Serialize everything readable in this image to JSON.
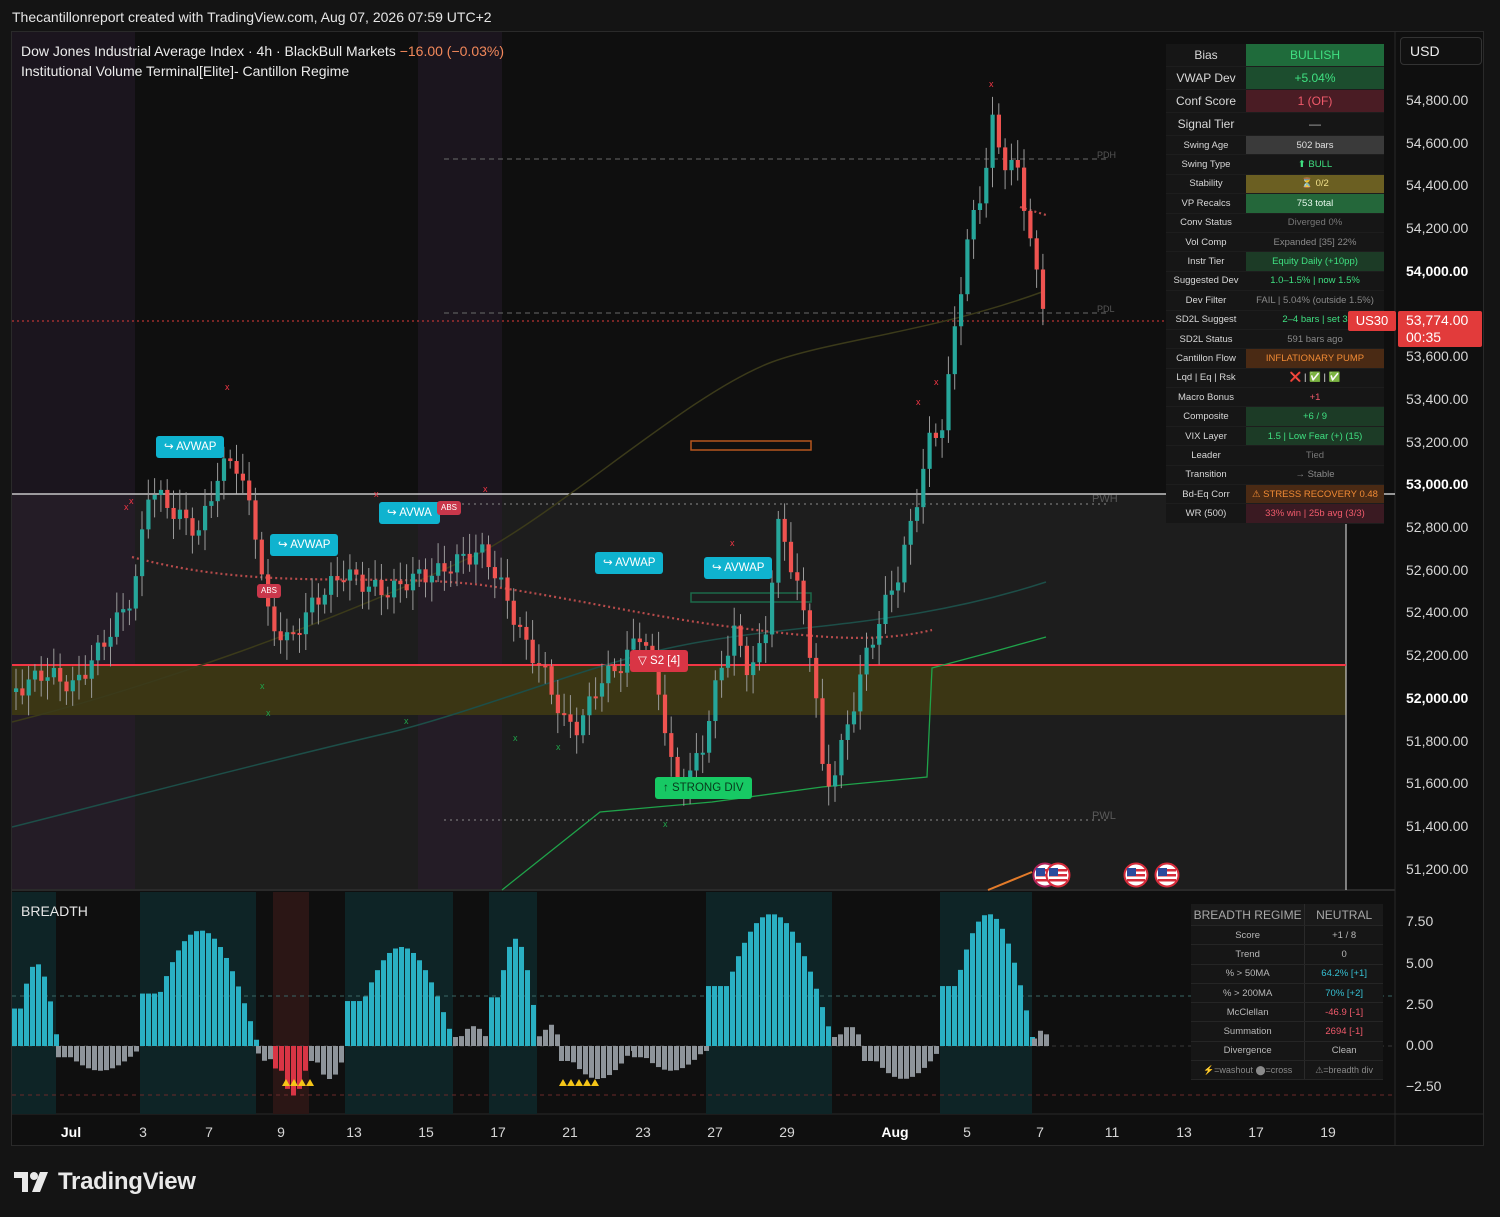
{
  "header": {
    "text": "Thecantillonreport created with TradingView.com, Aug 07, 2026 07:59 UTC+2"
  },
  "legend": {
    "line1": "Dow Jones Industrial Average Index · 4h · BlackBull Markets",
    "change": "−16.00 (−0.03%)",
    "line2": "Institutional Volume Terminal[Elite]- Cantillon Regime"
  },
  "currency_button": "USD",
  "price_axis": {
    "labels": [
      "54,800.00",
      "54,600.00",
      "54,400.00",
      "54,200.00",
      "54,000.00",
      "53,600.00",
      "53,400.00",
      "53,200.00",
      "53,000.00",
      "52,800.00",
      "52,600.00",
      "52,400.00",
      "52,200.00",
      "52,000.00",
      "51,800.00",
      "51,600.00",
      "51,400.00",
      "51,200.00"
    ],
    "bold_labels": [
      "54,000.00",
      "53,000.00",
      "52,000.00"
    ],
    "current_symbol": "US30",
    "current_price": "53,774.00",
    "countdown": "00:35"
  },
  "breadth_axis": {
    "labels": [
      "7.50",
      "5.00",
      "2.50",
      "0.00",
      "−2.50"
    ]
  },
  "time_axis": {
    "labels": [
      "Jul",
      "3",
      "7",
      "9",
      "13",
      "15",
      "17",
      "21",
      "23",
      "27",
      "29",
      "Aug",
      "5",
      "7",
      "11",
      "13",
      "17",
      "19"
    ],
    "bold_labels": [
      "Jul",
      "Aug"
    ]
  },
  "levels": {
    "pdh": "PDH",
    "pdl": "PDL",
    "pwh": "PWH",
    "pwl": "PWL"
  },
  "markers": {
    "avwap": "↪ AVWAP",
    "avwap_partial": "↪ AVWA",
    "abs": "ABS",
    "s2": "▽ S2 [4]",
    "strong_div": "↑ STRONG DIV",
    "x": "x"
  },
  "panel_table": [
    {
      "k": "Bias",
      "v": "BULLISH",
      "bg": "#1f6b3b",
      "fg": "#3fe081"
    },
    {
      "k": "VWAP Dev",
      "v": "+5.04%",
      "bg": "#1c4d2e",
      "fg": "#3fe081"
    },
    {
      "k": "Conf Score",
      "v": "1 (OF)",
      "bg": "#4a1c24",
      "fg": "#f05a6b"
    },
    {
      "k": "Signal Tier",
      "v": "—",
      "bg": "#161616",
      "fg": "#b0b0b0"
    },
    {
      "k": "Swing Age",
      "v": "502 bars",
      "bg": "#3a3a3a",
      "fg": "#e0e0e0"
    },
    {
      "k": "Swing Type",
      "v": "⬆ BULL",
      "bg": "#161616",
      "fg": "#3fe081"
    },
    {
      "k": "Stability",
      "v": "⏳ 0/2",
      "bg": "#6b5f22",
      "fg": "#f2e28c"
    },
    {
      "k": "VP Recalcs",
      "v": "753 total",
      "bg": "#24673a",
      "fg": "#e7f8ec"
    },
    {
      "k": "Conv Status",
      "v": "Diverged 0%",
      "bg": "#161616",
      "fg": "#777777"
    },
    {
      "k": "Vol Comp",
      "v": "Expanded [35] 22%",
      "bg": "#161616",
      "fg": "#8a8a8a"
    },
    {
      "k": "Instr Tier",
      "v": "Equity Daily (+10pp)",
      "bg": "#1c3b26",
      "fg": "#3fe081"
    },
    {
      "k": "Suggested Dev",
      "v": "1.0–1.5% | now 1.5%",
      "bg": "#161616",
      "fg": "#3fe081"
    },
    {
      "k": "Dev Filter",
      "v": "FAIL | 5.04% (outside 1.5%)",
      "bg": "#161616",
      "fg": "#8a8a8a"
    },
    {
      "k": "SD2L Suggest",
      "v": "2–4 bars | set 3",
      "bg": "#161616",
      "fg": "#3fe081"
    },
    {
      "k": "SD2L Status",
      "v": "591 bars ago",
      "bg": "#161616",
      "fg": "#8a8a8a"
    },
    {
      "k": "Cantillon Flow",
      "v": "INFLATIONARY PUMP",
      "bg": "#4a2a14",
      "fg": "#f08a34"
    },
    {
      "k": "Lqd | Eq | Rsk",
      "v": "❌ | ✅ | ✅",
      "bg": "#161616",
      "fg": "#e0e0e0"
    },
    {
      "k": "Macro Bonus",
      "v": "+1",
      "bg": "#161616",
      "fg": "#f05a6b"
    },
    {
      "k": "Composite",
      "v": "+6 / 9",
      "bg": "#1c3b26",
      "fg": "#3fe081"
    },
    {
      "k": "VIX Layer",
      "v": "1.5 | Low Fear (+) (15)",
      "bg": "#1c3b26",
      "fg": "#3fe081"
    },
    {
      "k": "Leader",
      "v": "Tied",
      "bg": "#161616",
      "fg": "#777777"
    },
    {
      "k": "Transition",
      "v": "→ Stable",
      "bg": "#161616",
      "fg": "#8a8a8a"
    },
    {
      "k": "Bd-Eq Corr",
      "v": "⚠ STRESS RECOVERY 0.48",
      "bg": "#4a2a14",
      "fg": "#f08a34"
    },
    {
      "k": "WR (500)",
      "v": "33% win | 25b avg (3/3)",
      "bg": "#3a1a22",
      "fg": "#f05a6b"
    }
  ],
  "breadth_table": {
    "head": {
      "k": "BREADTH REGIME",
      "v": "NEUTRAL"
    },
    "rows": [
      {
        "k": "Score",
        "v": "+1 / 8",
        "fg": "#b8b8b8"
      },
      {
        "k": "Trend",
        "v": "0",
        "fg": "#b8b8b8"
      },
      {
        "k": "% > 50MA",
        "v": "64.2%  [+1]",
        "fg": "#36c0d3"
      },
      {
        "k": "% > 200MA",
        "v": "70%  [+2]",
        "fg": "#36c0d3"
      },
      {
        "k": "McClellan",
        "v": "-46.9  [-1]",
        "fg": "#f05a6b"
      },
      {
        "k": "Summation",
        "v": "2694  [-1]",
        "fg": "#f05a6b"
      },
      {
        "k": "Divergence",
        "v": "Clean",
        "fg": "#b8b8b8"
      }
    ],
    "foot": {
      "k": "⚡=washout  ⬤=cross",
      "v": "⚠=breadth div"
    }
  },
  "breadth_title": "BREADTH",
  "brand": "TradingView",
  "colors": {
    "up": "#26a69a",
    "down": "#ef5350",
    "accent_cyan": "#0fb3cf",
    "level_red": "#f23645",
    "zone_olive": "#4a4418",
    "breadth_bar": "#2ab0c3",
    "breadth_neg": "#8e949a"
  },
  "icons": {
    "logo": "tradingview-logo-icon",
    "flag": "us-flag-icon"
  }
}
